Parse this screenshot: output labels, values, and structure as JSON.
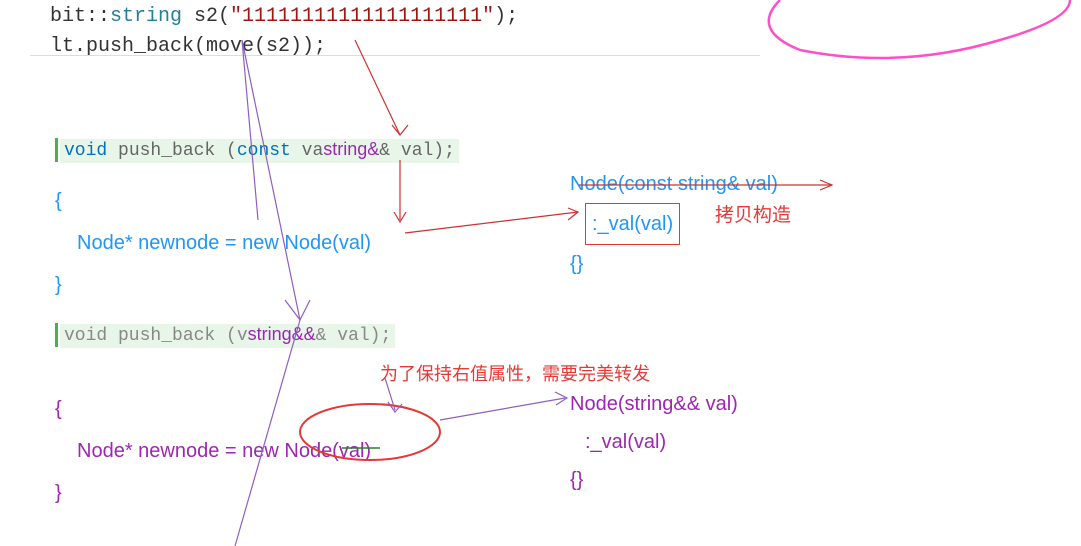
{
  "topCode": {
    "line1_part1": "bit::",
    "line1_type": "string",
    "line1_part2": " s2(",
    "line1_str": "\"11111111111111111111\"",
    "line1_part3": ");",
    "line2": "lt.push_back(move(s2));"
  },
  "sig1": {
    "void": "void",
    "name": " push_back (",
    "const": "const ",
    "grey": "va",
    "hl": "string&",
    "rest": "& val);"
  },
  "body1": {
    "open": "{",
    "line": "Node* newnode = new Node(val)",
    "close": "}"
  },
  "node1": {
    "head": "Node(const string& val)",
    "init": ":_val(val)",
    "body": "{}"
  },
  "anno1": "拷贝构造",
  "sig2": {
    "prefix": "void push_back (v",
    "hl": "string&&",
    "rest": "& val);"
  },
  "body2": {
    "open": "{",
    "line": "Node*  newnode = new Node(val)",
    "close": "}"
  },
  "anno2": "为了保持右值属性，需要完美转发",
  "node2": {
    "head": "Node(string&& val)",
    "init": ":_val(val)",
    "body": "{}"
  }
}
